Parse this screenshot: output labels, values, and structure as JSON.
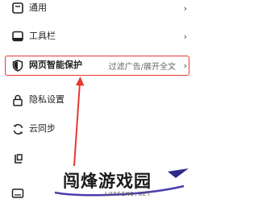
{
  "menu": {
    "items": [
      {
        "label": "通用",
        "icon": "general-settings-icon",
        "desc": ""
      },
      {
        "label": "工具栏",
        "icon": "toolbar-icon",
        "desc": ""
      },
      {
        "label": "网页智能保护",
        "icon": "shield-icon",
        "desc": "过滤广告/展开全文",
        "chevron": "›"
      },
      {
        "label": "隐私设置",
        "icon": "lock-icon",
        "desc": ""
      },
      {
        "label": "云同步",
        "icon": "sync-icon",
        "desc": ""
      },
      {
        "label": "",
        "icon": "partial-icon",
        "desc": ""
      }
    ]
  },
  "chevron": "›",
  "accent_color": "#e53935",
  "watermark": {
    "main": "闯烽游戏园",
    "sub": "LUOFENG.NET"
  }
}
